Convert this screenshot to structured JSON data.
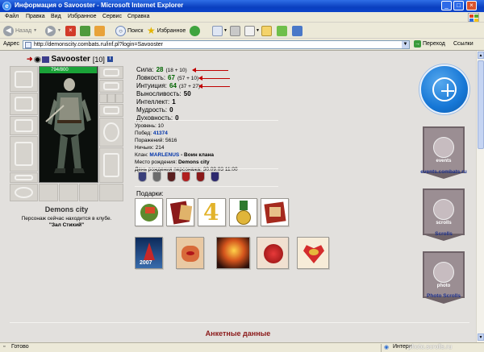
{
  "window": {
    "title": "Информация о Savooster - Microsoft Internet Explorer"
  },
  "menu": [
    "Файл",
    "Правка",
    "Вид",
    "Избранное",
    "Сервис",
    "Справка"
  ],
  "toolbar": {
    "back": "Назад",
    "search": "Поиск",
    "favorites": "Избранное"
  },
  "address": {
    "label": "Адрес",
    "url": "http://demonscity.combats.ru/inf.pl?login=Savooster",
    "go": "Переход",
    "links": "Ссылки"
  },
  "character": {
    "nick": "Savooster",
    "level": "[10]",
    "hp_text": "794/800",
    "hp_fraction": 0.99,
    "city": "Demons city",
    "status": "Персонаж сейчас находится в клубе.",
    "room": "\"Зал Стихий\""
  },
  "stats": [
    {
      "label": "Сила:",
      "value": "28",
      "bonus": "(18 + 10)",
      "green": true
    },
    {
      "label": "Ловкость:",
      "value": "67",
      "bonus": "(57 + 10)",
      "green": true
    },
    {
      "label": "Интуиция:",
      "value": "64",
      "bonus": "(37 + 27)",
      "green": true
    },
    {
      "label": "Выносливость:",
      "value": "50",
      "bonus": "",
      "green": false
    },
    {
      "label": "Интеллект:",
      "value": "1",
      "bonus": "",
      "green": false
    },
    {
      "label": "Мудрость:",
      "value": "0",
      "bonus": "",
      "green": false
    },
    {
      "label": "Духовность:",
      "value": "0",
      "bonus": "",
      "green": false
    }
  ],
  "info": {
    "level_label": "Уровень:",
    "level": "10",
    "wins_label": "Побед:",
    "wins": "41374",
    "losses_label": "Поражений:",
    "losses": "5616",
    "draws_label": "Ничьих:",
    "draws": "214",
    "clan_label": "Клан:",
    "clan": "MARLENUS",
    "clan_role": "- Воин клана",
    "birthplace_label": "Место рождения:",
    "birthplace": "Demons city",
    "birthday_label": "День рождения персонажа:",
    "birthday": "30.09.03 11:00"
  },
  "gifts_label": "Подарки:",
  "right_panel": {
    "events_label": "events.combats.ru",
    "events_caption": "events",
    "scrolls_label": "Scrolls",
    "scrolls_caption": "scrolls",
    "photo_label": "Photo Scrolls",
    "photo_caption": "photo"
  },
  "anketa_title": "Анкетные данные",
  "status_bar": {
    "left": "Готово",
    "zone": "Интерн",
    "watermark": "photo.scrolls.ru"
  }
}
